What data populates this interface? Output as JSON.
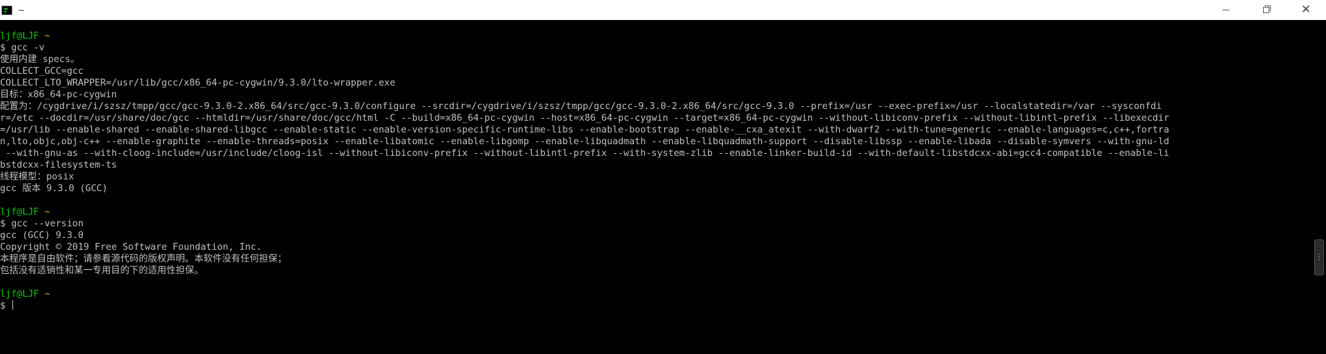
{
  "titlebar": {
    "title": "~",
    "icon": "terminal-icon",
    "controls": {
      "minimize": "minimize-icon",
      "maximize": "restore-icon",
      "close": "close-icon",
      "close_glyph": "✕"
    }
  },
  "colors": {
    "background": "#000000",
    "text": "#c0c0c0",
    "prompt_user": "#00cc00",
    "prompt_path": "#c8c800"
  },
  "terminal": {
    "prompt_user": "ljf@LJF",
    "prompt_path": "~",
    "blocks": [
      {
        "command": "$ gcc -v",
        "output": [
          "使用内建 specs。",
          "COLLECT_GCC=gcc",
          "COLLECT_LTO_WRAPPER=/usr/lib/gcc/x86_64-pc-cygwin/9.3.0/lto-wrapper.exe",
          "目标：x86_64-pc-cygwin",
          "配置为：/cygdrive/i/szsz/tmpp/gcc/gcc-9.3.0-2.x86_64/src/gcc-9.3.0/configure --srcdir=/cygdrive/i/szsz/tmpp/gcc/gcc-9.3.0-2.x86_64/src/gcc-9.3.0 --prefix=/usr --exec-prefix=/usr --localstatedir=/var --sysconfdi",
          "r=/etc --docdir=/usr/share/doc/gcc --htmldir=/usr/share/doc/gcc/html -C --build=x86_64-pc-cygwin --host=x86_64-pc-cygwin --target=x86_64-pc-cygwin --without-libiconv-prefix --without-libintl-prefix --libexecdir",
          "=/usr/lib --enable-shared --enable-shared-libgcc --enable-static --enable-version-specific-runtime-libs --enable-bootstrap --enable-__cxa_atexit --with-dwarf2 --with-tune=generic --enable-languages=c,c++,fortra",
          "n,lto,objc,obj-c++ --enable-graphite --enable-threads=posix --enable-libatomic --enable-libgomp --enable-libquadmath --enable-libquadmath-support --disable-libssp --enable-libada --disable-symvers --with-gnu-ld",
          " --with-gnu-as --with-cloog-include=/usr/include/cloog-isl --without-libiconv-prefix --without-libintl-prefix --with-system-zlib --enable-linker-build-id --with-default-libstdcxx-abi=gcc4-compatible --enable-li",
          "bstdcxx-filesystem-ts",
          "线程模型：posix",
          "gcc 版本 9.3.0 (GCC)"
        ]
      },
      {
        "command": "$ gcc --version",
        "output": [
          "gcc (GCC) 9.3.0",
          "Copyright © 2019 Free Software Foundation, Inc.",
          "本程序是自由软件；请参看源代码的版权声明。本软件没有任何担保；",
          "包括没有适销性和某一专用目的下的适用性担保。"
        ]
      }
    ],
    "current_prompt": "$ "
  }
}
